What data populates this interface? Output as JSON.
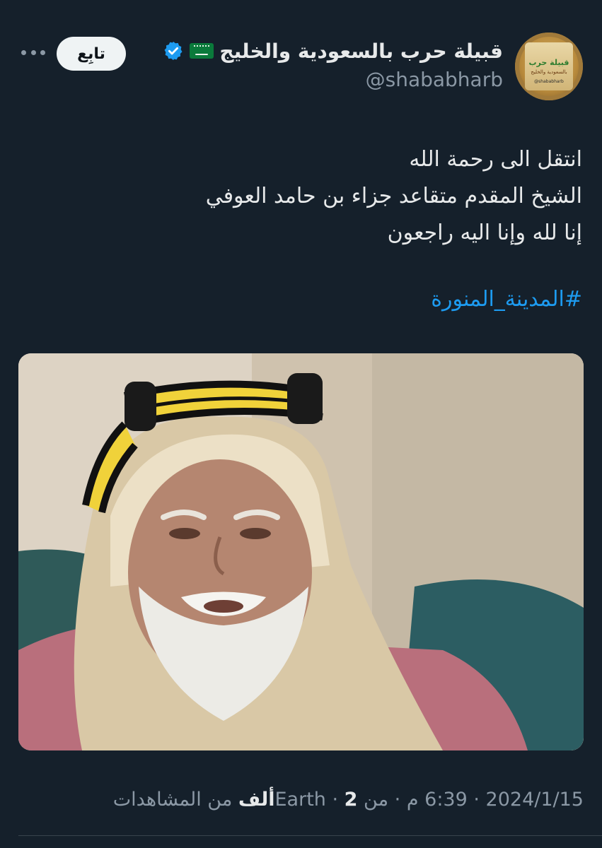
{
  "author": {
    "display_name": "قبيلة حرب بالسعودية والخليج",
    "handle": "@shababharb",
    "avatar": {
      "line1": "قبيلة حرب",
      "line2": "بالسعودية والخليج",
      "line3": "@shababharb"
    },
    "flag_icon": "saudi-flag-icon",
    "verified_icon": "verified-badge-icon",
    "verified_color": "#1d9bf0"
  },
  "actions": {
    "follow_label": "تابِع",
    "more_icon": "more-icon"
  },
  "tweet": {
    "lines": [
      "انتقل الى رحمة الله",
      "الشيخ المقدم متقاعد جزاء بن حامد العوفي",
      "إنا لله وإنا اليه راجعون"
    ],
    "hashtag": "#المدينة_المنورة",
    "hashtag_color": "#1d9bf0"
  },
  "meta": {
    "date": "2024/1/15",
    "time": "6:39 م",
    "source": "من Earth",
    "views_count": "2ألف",
    "views_label": "من المشاهدات"
  },
  "colors": {
    "background": "#15202b",
    "text": "#e7e9ea",
    "secondary_text": "#8b98a5"
  }
}
